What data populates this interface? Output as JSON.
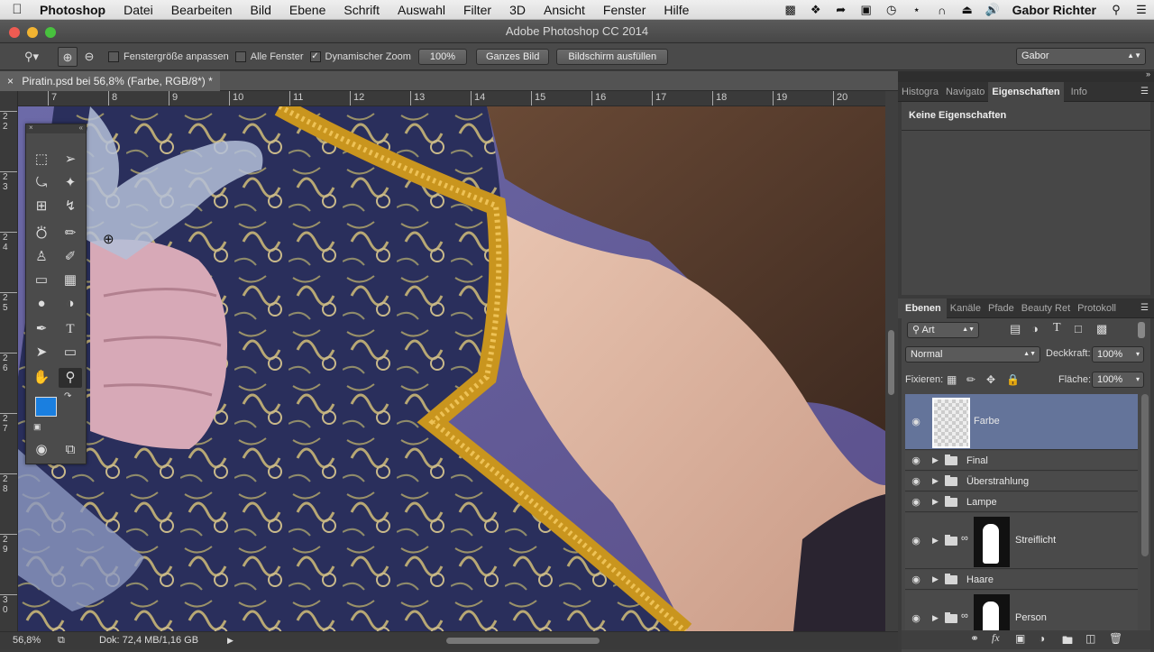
{
  "menubar": {
    "apple": "",
    "app": "Photoshop",
    "items": [
      "Datei",
      "Bearbeiten",
      "Bild",
      "Ebene",
      "Schrift",
      "Auswahl",
      "Filter",
      "3D",
      "Ansicht",
      "Fenster",
      "Hilfe"
    ],
    "user": "Gabor Richter"
  },
  "window": {
    "title": "Adobe Photoshop CC 2014"
  },
  "options": {
    "fit_window_label": "Fenstergröße anpassen",
    "all_windows_label": "Alle Fenster",
    "dynamic_zoom_label": "Dynamischer Zoom",
    "zoom_100_label": "100%",
    "fit_screen_label": "Ganzes Bild",
    "fill_screen_label": "Bildschirm ausfüllen",
    "workspace": "Gabor"
  },
  "document": {
    "tab_close": "×",
    "tab_title": "Piratin.psd bei 56,8% (Farbe, RGB/8*) *"
  },
  "rulers": {
    "h_ticks": [
      "7",
      "8",
      "9",
      "10",
      "11",
      "12",
      "13",
      "14",
      "15",
      "16",
      "17",
      "18",
      "19",
      "20"
    ],
    "v_ticks": [
      "2\n2",
      "2\n3",
      "2\n4",
      "2\n5",
      "2\n6",
      "2\n7",
      "2\n8",
      "2\n9",
      "3\n0"
    ]
  },
  "status": {
    "zoom": "56,8%",
    "doc_info": "Dok: 72,4 MB/1,16 GB"
  },
  "panels": {
    "top_tabs": [
      "Histogra",
      "Navigato",
      "Eigenschaften",
      "Info"
    ],
    "properties_text": "Keine Eigenschaften",
    "layer_tabs": [
      "Ebenen",
      "Kanäle",
      "Pfade",
      "Beauty Ret",
      "Protokoll"
    ],
    "filter_kind": "Art",
    "blend_mode": "Normal",
    "opacity_label": "Deckkraft:",
    "opacity_value": "100%",
    "lock_label": "Fixieren:",
    "fill_label": "Fläche:",
    "fill_value": "100%",
    "layers": [
      {
        "name": "Farbe"
      },
      {
        "name": "Final"
      },
      {
        "name": "Überstrahlung"
      },
      {
        "name": "Lampe"
      },
      {
        "name": "Streiflicht"
      },
      {
        "name": "Haare"
      },
      {
        "name": "Person"
      }
    ]
  },
  "colors": {
    "foreground": "#1a7fe0",
    "background": "#000000",
    "selected_layer": "#64749a"
  }
}
